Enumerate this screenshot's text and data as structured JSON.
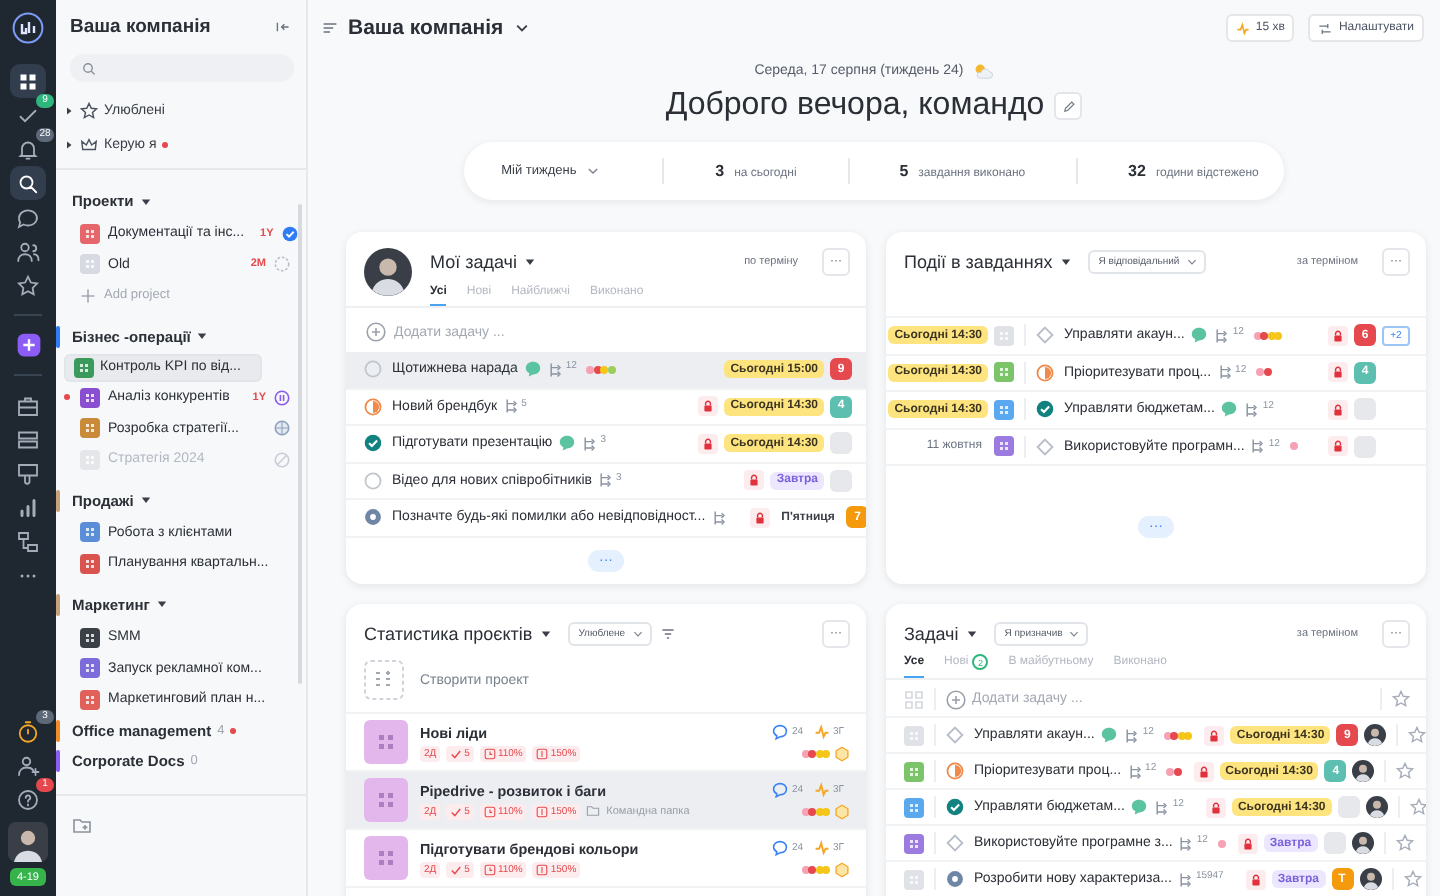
{
  "rail": {
    "logo": {
      "kind": "logo"
    },
    "groups": [
      [
        {
          "kind": "grid",
          "selected": true
        },
        {
          "kind": "check",
          "selected": false,
          "badge": {
            "text": "9",
            "color": "#2fb67c"
          }
        },
        {
          "kind": "bell",
          "selected": false,
          "badge": {
            "text": "28",
            "color": "#5d6878"
          }
        },
        {
          "kind": "search",
          "selected": true
        },
        {
          "kind": "chat",
          "selected": false
        },
        {
          "kind": "people",
          "selected": false
        },
        {
          "kind": "star",
          "selected": false
        }
      ],
      [
        {
          "kind": "plus",
          "selected": false
        }
      ],
      [
        {
          "kind": "briefcase",
          "selected": false
        },
        {
          "kind": "stack",
          "selected": false
        },
        {
          "kind": "thumbs",
          "selected": false
        },
        {
          "kind": "bars",
          "selected": false
        },
        {
          "kind": "hierarchy",
          "selected": false
        },
        {
          "kind": "more",
          "selected": false
        }
      ]
    ],
    "bottom": [
      {
        "kind": "timer",
        "selected": false,
        "badge": {
          "text": "3",
          "color": "#5d6878"
        }
      },
      {
        "kind": "add-user",
        "selected": false
      },
      {
        "kind": "help",
        "selected": false,
        "badge": {
          "text": "1",
          "color": "#e5484d"
        }
      }
    ],
    "user": {
      "kind": "avatar"
    },
    "plan_label": "4-19"
  },
  "sidebar": {
    "title": "Ваша компанія",
    "favorites": [
      {
        "label": "Улюблені",
        "kind": "star",
        "dot": false
      },
      {
        "label": "Керую я",
        "kind": "crown",
        "dot": true
      }
    ],
    "sections": [
      {
        "name": "Проекти",
        "expanded": true,
        "add_label": "Add project",
        "items": [
          {
            "kind": "done",
            "label": "Документації та інс...",
            "color": "#e5676b",
            "selected": false,
            "disabled": false,
            "dot": false,
            "badge": "1Y"
          },
          {
            "kind": "planned",
            "label": "Old",
            "color": "#d7dae0",
            "selected": false,
            "disabled": false,
            "dot": false,
            "badge": "2M"
          }
        ]
      },
      {
        "name": "Бізнес -операції",
        "color": "#2f7cf6",
        "expanded": true,
        "items": [
          {
            "kind": "plain",
            "label": "Контроль KPI по від...",
            "color": "#3a9a5c",
            "selected": true,
            "disabled": false,
            "dot": false
          },
          {
            "kind": "paused",
            "label": "Аналіз конкурентів",
            "color": "#8a4fd1",
            "selected": false,
            "disabled": false,
            "dot": true,
            "badge": "1Y"
          },
          {
            "kind": "review",
            "label": "Розробка стратегії...",
            "color": "#c98a3a",
            "selected": false,
            "disabled": false,
            "dot": false
          },
          {
            "kind": "archived",
            "label": "Стратегія 2024",
            "color": "#e4e6ea",
            "selected": false,
            "disabled": true,
            "dot": false
          }
        ]
      },
      {
        "name": "Продажі",
        "color": "#c9a27a",
        "expanded": true,
        "items": [
          {
            "kind": "plain",
            "label": "Робота з клієнтами",
            "color": "#5a8fd8",
            "selected": false,
            "disabled": false,
            "dot": false
          },
          {
            "kind": "plain",
            "label": "Планування квартальн...",
            "color": "#d9534f",
            "selected": false,
            "disabled": false,
            "dot": false
          }
        ]
      },
      {
        "name": "Маркетинг",
        "color": "#c9a27a",
        "expanded": true,
        "items": [
          {
            "kind": "plain",
            "label": "SMM",
            "color": "#3b3f46",
            "selected": false,
            "disabled": false,
            "dot": false
          },
          {
            "kind": "plain",
            "label": "Запуск рекламної ком...",
            "color": "#7b6cd9",
            "selected": false,
            "disabled": false,
            "dot": false
          },
          {
            "kind": "plain",
            "label": "Маркетинговий план н...",
            "color": "#e0605a",
            "selected": false,
            "disabled": false,
            "dot": false
          }
        ]
      },
      {
        "name": "Office management",
        "color": "#f28c28",
        "count": "4",
        "dot": true
      },
      {
        "name": "Corporate Docs",
        "color": "#8b5cf6",
        "count": "0",
        "dot": false
      }
    ]
  },
  "header": {
    "title": "Ваша компанія",
    "timer": "15 хв",
    "settings": "Налаштувати"
  },
  "hero": {
    "date": "Середа, 17 серпня (тиждень 24)",
    "greeting": "Доброго вечора, командо",
    "period": "Мій тиждень",
    "stats": [
      {
        "value": "3",
        "label": "на сьогодні"
      },
      {
        "value": "5",
        "label": "завдання виконано"
      },
      {
        "value": "32",
        "label": "години відстежено"
      }
    ]
  },
  "my_tasks": {
    "title": "Мої задачі",
    "sort": "по терміну",
    "menu": "···",
    "more": "···",
    "add": "Додати задачу ...",
    "tabs": [
      {
        "label": "Усі",
        "selected": true
      },
      {
        "label": "Нові",
        "selected": false
      },
      {
        "label": "Найближчі",
        "selected": false
      },
      {
        "label": "Виконано",
        "selected": false
      }
    ],
    "rows": [
      {
        "kind": "open",
        "name": "Щотижнева нарада",
        "selected": true,
        "chat": true,
        "has_subtasks": true,
        "subtasks": "12",
        "tags": [
          {
            "color": "#f7a1b5"
          },
          {
            "color": "#e5484d"
          },
          {
            "color": "#f5c518"
          },
          {
            "color": "#9ccf5a"
          }
        ],
        "lock": false,
        "due": {
          "text": "Сьогодні 15:00",
          "kind": "today"
        },
        "badge": {
          "text": "9",
          "color": "#e5484d"
        }
      },
      {
        "kind": "progress",
        "name": "Новий брендбук",
        "selected": false,
        "chat": false,
        "has_subtasks": true,
        "subtasks": "5",
        "lock": true,
        "due": {
          "text": "Сьогодні 14:30",
          "kind": "today"
        },
        "badge": {
          "text": "4",
          "color": "#5cbfb0"
        }
      },
      {
        "kind": "done",
        "name": "Підготувати презентацію",
        "selected": false,
        "chat": true,
        "has_subtasks": true,
        "subtasks": "3",
        "lock": true,
        "due": {
          "text": "Сьогодні 14:30",
          "kind": "today"
        },
        "badge": {
          "color": "#e6e8eb"
        }
      },
      {
        "kind": "open",
        "name": "Відео для нових співробітників",
        "selected": false,
        "chat": false,
        "has_subtasks": true,
        "subtasks": "3",
        "lock": true,
        "due": {
          "text": "Завтра",
          "kind": "tomorrow"
        },
        "badge": {
          "color": "#e6e8eb"
        }
      },
      {
        "kind": "review",
        "name": "Позначте будь-які помилки або невідповідност...",
        "selected": false,
        "chat": false,
        "has_subtasks": true,
        "lock": true,
        "due": {
          "text": "П'ятниця",
          "kind": "plain"
        },
        "badge": {
          "text": "7",
          "color": "#f59a0c"
        }
      }
    ]
  },
  "events": {
    "title": "Події в завданнях",
    "filter": "Я відповідальний",
    "sort": "за терміном",
    "menu": "···",
    "more": "···",
    "rows": [
      {
        "date": {
          "text": "Сьогодні 14:30",
          "kind": "today"
        },
        "color": "#dfe2e7",
        "name": "Управляти акаун...",
        "kind": "open",
        "chat": true,
        "subtasks": "12",
        "tags": [
          {
            "color": "#f7a1b5"
          },
          {
            "color": "#e5484d"
          },
          {
            "color": "#f5c518"
          },
          {
            "color": "#f5c518"
          }
        ],
        "lock": true,
        "badge": {
          "text": "6",
          "color": "#e5484d"
        },
        "extra": "+2"
      },
      {
        "date": {
          "text": "Сьогодні 14:30",
          "kind": "today"
        },
        "color": "#7cc46a",
        "name": "Пріоритезувати проц...",
        "kind": "progress",
        "chat": false,
        "subtasks": "12",
        "tags": [
          {
            "color": "#f7a1b5"
          },
          {
            "color": "#e5484d"
          }
        ],
        "lock": true,
        "badge": {
          "text": "4",
          "color": "#5cbfb0"
        }
      },
      {
        "date": {
          "text": "Сьогодні 14:30",
          "kind": "today"
        },
        "color": "#5aa9f0",
        "name": "Управляти бюджетам...",
        "kind": "done",
        "chat": true,
        "subtasks": "12",
        "lock": true,
        "badge": {
          "color": "#e6e8eb"
        }
      },
      {
        "date": {
          "text": "11 жовтня",
          "kind": "plain"
        },
        "color": "#9b7be0",
        "name": "Використовуйте програмн...",
        "kind": "open",
        "chat": false,
        "subtasks": "12",
        "tags": [
          {
            "color": "#f7a1b5"
          }
        ],
        "lock": true,
        "badge": {
          "color": "#e6e8eb"
        }
      }
    ]
  },
  "project_stats": {
    "title": "Статистика проєктів",
    "filter": "Улюблене",
    "menu": "···",
    "create": "Створити проект",
    "projects": [
      {
        "name": "Нові ліди",
        "selected": false,
        "days": "2Д",
        "done": "5",
        "time": "110%",
        "budget": "150%",
        "comments": "24",
        "hours": "3Г",
        "tags": [
          {
            "color": "#f7a1b5"
          },
          {
            "color": "#e5484d"
          },
          {
            "color": "#f5c518"
          },
          {
            "color": "#f5c518"
          }
        ]
      },
      {
        "name": "Pipedrive - розвиток і баги",
        "selected": true,
        "days": "2Д",
        "done": "5",
        "time": "110%",
        "budget": "150%",
        "comments": "24",
        "hours": "3Г",
        "folder": "Командна папка",
        "tags": [
          {
            "color": "#f7a1b5"
          },
          {
            "color": "#e5484d"
          },
          {
            "color": "#f5c518"
          },
          {
            "color": "#f5c518"
          }
        ]
      },
      {
        "name": "Підготувати брендові кольори",
        "selected": false,
        "days": "2Д",
        "done": "5",
        "time": "110%",
        "budget": "150%",
        "comments": "24",
        "hours": "3Г",
        "tags": [
          {
            "color": "#f7a1b5"
          },
          {
            "color": "#e5484d"
          },
          {
            "color": "#f5c518"
          },
          {
            "color": "#f5c518"
          }
        ]
      }
    ]
  },
  "tasks": {
    "title": "Задачі",
    "filter": "Я призначив",
    "sort": "за терміном",
    "menu": "···",
    "add": "Додати задачу ...",
    "tabs": [
      {
        "label": "Усе",
        "selected": true
      },
      {
        "label": "Нові",
        "selected": false,
        "count": "2"
      },
      {
        "label": "В майбутньому",
        "selected": false
      },
      {
        "label": "Виконано",
        "selected": false
      }
    ],
    "rows": [
      {
        "color": "#dfe2e7",
        "name": "Управляти акаун...",
        "kind": "open",
        "chat": true,
        "subtasks": "12",
        "tags": [
          {
            "color": "#f7a1b5"
          },
          {
            "color": "#e5484d"
          },
          {
            "color": "#f5c518"
          },
          {
            "color": "#f5c518"
          }
        ],
        "lock": true,
        "due": {
          "text": "Сьогодні 14:30",
          "kind": "today"
        },
        "badge": {
          "text": "9",
          "color": "#e5484d"
        }
      },
      {
        "color": "#7cc46a",
        "name": "Пріоритезувати проц...",
        "kind": "progress",
        "chat": false,
        "subtasks": "12",
        "tags": [
          {
            "color": "#f7a1b5"
          },
          {
            "color": "#e5484d"
          }
        ],
        "lock": true,
        "due": {
          "text": "Сьогодні 14:30",
          "kind": "today"
        },
        "badge": {
          "text": "4",
          "color": "#5cbfb0"
        }
      },
      {
        "color": "#5aa9f0",
        "name": "Управляти бюджетам...",
        "kind": "done",
        "chat": true,
        "subtasks": "12",
        "lock": true,
        "due": {
          "text": "Сьогодні 14:30",
          "kind": "today"
        },
        "badge": {
          "color": "#e6e8eb"
        }
      },
      {
        "color": "#9b7be0",
        "name": "Використовуйте програмне з...",
        "kind": "open",
        "chat": false,
        "subtasks": "12",
        "tags": [
          {
            "color": "#f7a1b5"
          }
        ],
        "lock": true,
        "due": {
          "text": "Завтра",
          "kind": "tomorrow"
        },
        "badge": {
          "color": "#e6e8eb"
        }
      },
      {
        "color": "#dfe2e7",
        "name": "Розробити нову характеризa...",
        "kind": "review",
        "chat": false,
        "subtasks": "15947",
        "lock": true,
        "due": {
          "text": "Завтра",
          "kind": "tomorrow"
        },
        "badge": {
          "text": "T",
          "color": "#f59a0c"
        }
      }
    ]
  }
}
